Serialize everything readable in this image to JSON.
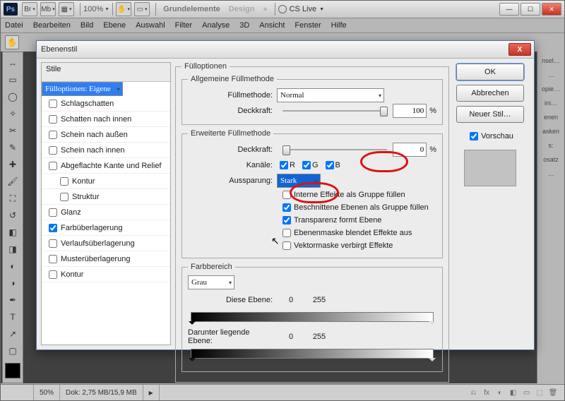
{
  "titlebar": {
    "zoom": "100%",
    "btn_grundelemente": "Grundelemente",
    "btn_design": "Design",
    "cslive": "CS Live"
  },
  "menu": [
    "Datei",
    "Bearbeiten",
    "Bild",
    "Ebene",
    "Auswahl",
    "Filter",
    "Analyse",
    "3D",
    "Ansicht",
    "Fenster",
    "Hilfe"
  ],
  "status": {
    "zoom": "50%",
    "dok": "Dok: 2,75 MB/15,9 MB"
  },
  "rightTabs": [
    "nsel…",
    "…",
    "opie…",
    "ini…",
    "enen",
    "asken",
    "s:",
    "osatz",
    "…"
  ],
  "dialog": {
    "title": "Ebenenstil",
    "styles_header": "Stile",
    "styles": [
      {
        "label": "Fülloptionen: Eigene",
        "selected": true
      },
      {
        "label": "Schlagschatten",
        "checked": false
      },
      {
        "label": "Schatten nach innen",
        "checked": false
      },
      {
        "label": "Schein nach außen",
        "checked": false
      },
      {
        "label": "Schein nach innen",
        "checked": false
      },
      {
        "label": "Abgeflachte Kante und Relief",
        "checked": false
      },
      {
        "label": "Kontur",
        "checked": false,
        "indent": true
      },
      {
        "label": "Struktur",
        "checked": false,
        "indent": true
      },
      {
        "label": "Glanz",
        "checked": false
      },
      {
        "label": "Farbüberlagerung",
        "checked": true
      },
      {
        "label": "Verlaufsüberlagerung",
        "checked": false
      },
      {
        "label": "Musterüberlagerung",
        "checked": false
      },
      {
        "label": "Kontur",
        "checked": false
      }
    ],
    "fill": {
      "legend_main": "Fülloptionen",
      "legend_general": "Allgemeine Füllmethode",
      "lab_method": "Füllmethode:",
      "method": "Normal",
      "lab_opacity1": "Deckkraft:",
      "opacity1": "100",
      "pct": "%",
      "legend_adv": "Erweiterte Füllmethode",
      "lab_opacity2": "Deckkraft:",
      "opacity2": "0",
      "lab_channels": "Kanäle:",
      "ch_r": "R",
      "ch_g": "G",
      "ch_b": "B",
      "lab_aus": "Aussparung:",
      "aus_val": "Stark",
      "cbx": [
        {
          "checked": false,
          "label": "Interne Effekte als Gruppe füllen"
        },
        {
          "checked": true,
          "label": "Beschnittene Ebenen als Gruppe füllen"
        },
        {
          "checked": true,
          "label": "Transparenz formt Ebene"
        },
        {
          "checked": false,
          "label": "Ebenenmaske blendet Effekte aus"
        },
        {
          "checked": false,
          "label": "Vektormaske verbirgt Effekte"
        }
      ],
      "legend_color": "Farbbereich",
      "color_sel": "Grau",
      "lab_this": "Diese Ebene:",
      "this_lo": "0",
      "this_hi": "255",
      "lab_under": "Darunter liegende Ebene:",
      "under_lo": "0",
      "under_hi": "255"
    },
    "buttons": {
      "ok": "OK",
      "cancel": "Abbrechen",
      "new": "Neuer Stil…",
      "preview": "Vorschau"
    }
  }
}
